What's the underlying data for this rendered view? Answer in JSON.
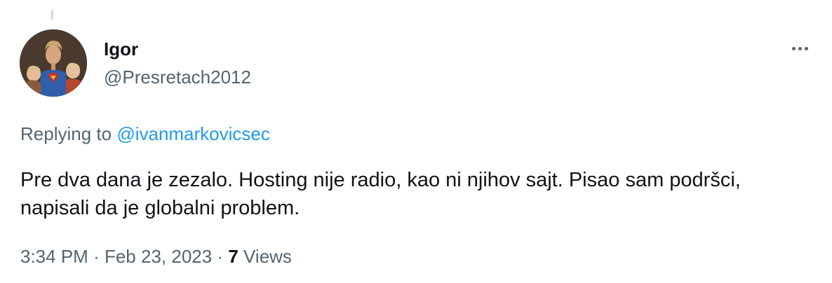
{
  "tweet": {
    "author": {
      "display_name": "Igor",
      "handle": "@Presretach2012"
    },
    "replying_prefix": "Replying to",
    "replying_to": "@ivanmarkovicsec",
    "text": "Pre dva dana je zezalo. Hosting nije radio, kao ni njihov sajt. Pisao sam podršci, napisali da je globalni problem.",
    "time": "3:34 PM",
    "separator": "·",
    "date": "Feb 23, 2023",
    "views_count": "7",
    "views_label": "Views"
  },
  "icons": {
    "more": "more-horizontal-icon"
  },
  "colors": {
    "text_primary": "#0f1419",
    "text_secondary": "#536471",
    "link": "#1d9bf0",
    "thread_line": "#cfd9de"
  }
}
